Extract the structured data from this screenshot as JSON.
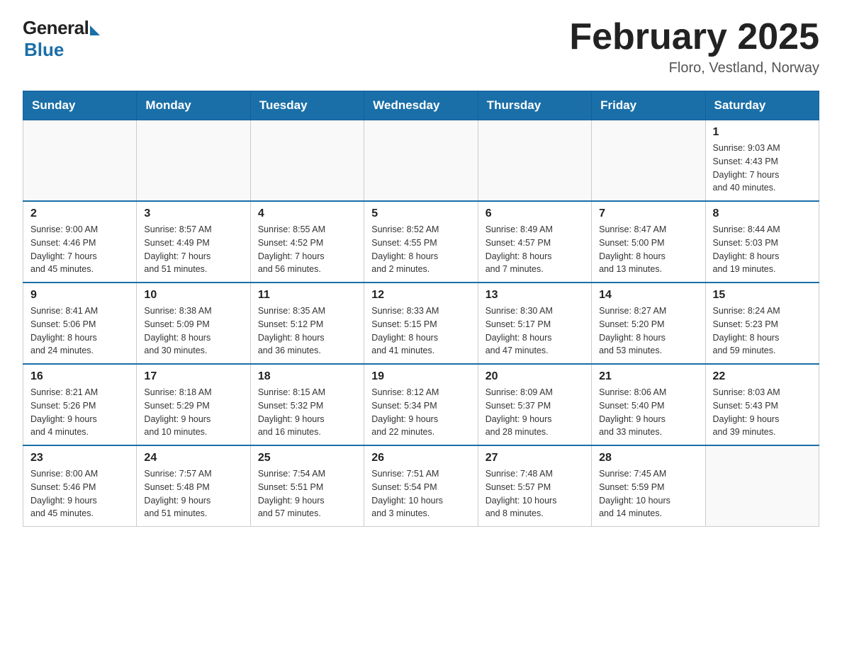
{
  "header": {
    "logo_general": "General",
    "logo_blue": "Blue",
    "main_title": "February 2025",
    "subtitle": "Floro, Vestland, Norway"
  },
  "days_of_week": [
    "Sunday",
    "Monday",
    "Tuesday",
    "Wednesday",
    "Thursday",
    "Friday",
    "Saturday"
  ],
  "weeks": [
    [
      {
        "day": "",
        "info": ""
      },
      {
        "day": "",
        "info": ""
      },
      {
        "day": "",
        "info": ""
      },
      {
        "day": "",
        "info": ""
      },
      {
        "day": "",
        "info": ""
      },
      {
        "day": "",
        "info": ""
      },
      {
        "day": "1",
        "info": "Sunrise: 9:03 AM\nSunset: 4:43 PM\nDaylight: 7 hours\nand 40 minutes."
      }
    ],
    [
      {
        "day": "2",
        "info": "Sunrise: 9:00 AM\nSunset: 4:46 PM\nDaylight: 7 hours\nand 45 minutes."
      },
      {
        "day": "3",
        "info": "Sunrise: 8:57 AM\nSunset: 4:49 PM\nDaylight: 7 hours\nand 51 minutes."
      },
      {
        "day": "4",
        "info": "Sunrise: 8:55 AM\nSunset: 4:52 PM\nDaylight: 7 hours\nand 56 minutes."
      },
      {
        "day": "5",
        "info": "Sunrise: 8:52 AM\nSunset: 4:55 PM\nDaylight: 8 hours\nand 2 minutes."
      },
      {
        "day": "6",
        "info": "Sunrise: 8:49 AM\nSunset: 4:57 PM\nDaylight: 8 hours\nand 7 minutes."
      },
      {
        "day": "7",
        "info": "Sunrise: 8:47 AM\nSunset: 5:00 PM\nDaylight: 8 hours\nand 13 minutes."
      },
      {
        "day": "8",
        "info": "Sunrise: 8:44 AM\nSunset: 5:03 PM\nDaylight: 8 hours\nand 19 minutes."
      }
    ],
    [
      {
        "day": "9",
        "info": "Sunrise: 8:41 AM\nSunset: 5:06 PM\nDaylight: 8 hours\nand 24 minutes."
      },
      {
        "day": "10",
        "info": "Sunrise: 8:38 AM\nSunset: 5:09 PM\nDaylight: 8 hours\nand 30 minutes."
      },
      {
        "day": "11",
        "info": "Sunrise: 8:35 AM\nSunset: 5:12 PM\nDaylight: 8 hours\nand 36 minutes."
      },
      {
        "day": "12",
        "info": "Sunrise: 8:33 AM\nSunset: 5:15 PM\nDaylight: 8 hours\nand 41 minutes."
      },
      {
        "day": "13",
        "info": "Sunrise: 8:30 AM\nSunset: 5:17 PM\nDaylight: 8 hours\nand 47 minutes."
      },
      {
        "day": "14",
        "info": "Sunrise: 8:27 AM\nSunset: 5:20 PM\nDaylight: 8 hours\nand 53 minutes."
      },
      {
        "day": "15",
        "info": "Sunrise: 8:24 AM\nSunset: 5:23 PM\nDaylight: 8 hours\nand 59 minutes."
      }
    ],
    [
      {
        "day": "16",
        "info": "Sunrise: 8:21 AM\nSunset: 5:26 PM\nDaylight: 9 hours\nand 4 minutes."
      },
      {
        "day": "17",
        "info": "Sunrise: 8:18 AM\nSunset: 5:29 PM\nDaylight: 9 hours\nand 10 minutes."
      },
      {
        "day": "18",
        "info": "Sunrise: 8:15 AM\nSunset: 5:32 PM\nDaylight: 9 hours\nand 16 minutes."
      },
      {
        "day": "19",
        "info": "Sunrise: 8:12 AM\nSunset: 5:34 PM\nDaylight: 9 hours\nand 22 minutes."
      },
      {
        "day": "20",
        "info": "Sunrise: 8:09 AM\nSunset: 5:37 PM\nDaylight: 9 hours\nand 28 minutes."
      },
      {
        "day": "21",
        "info": "Sunrise: 8:06 AM\nSunset: 5:40 PM\nDaylight: 9 hours\nand 33 minutes."
      },
      {
        "day": "22",
        "info": "Sunrise: 8:03 AM\nSunset: 5:43 PM\nDaylight: 9 hours\nand 39 minutes."
      }
    ],
    [
      {
        "day": "23",
        "info": "Sunrise: 8:00 AM\nSunset: 5:46 PM\nDaylight: 9 hours\nand 45 minutes."
      },
      {
        "day": "24",
        "info": "Sunrise: 7:57 AM\nSunset: 5:48 PM\nDaylight: 9 hours\nand 51 minutes."
      },
      {
        "day": "25",
        "info": "Sunrise: 7:54 AM\nSunset: 5:51 PM\nDaylight: 9 hours\nand 57 minutes."
      },
      {
        "day": "26",
        "info": "Sunrise: 7:51 AM\nSunset: 5:54 PM\nDaylight: 10 hours\nand 3 minutes."
      },
      {
        "day": "27",
        "info": "Sunrise: 7:48 AM\nSunset: 5:57 PM\nDaylight: 10 hours\nand 8 minutes."
      },
      {
        "day": "28",
        "info": "Sunrise: 7:45 AM\nSunset: 5:59 PM\nDaylight: 10 hours\nand 14 minutes."
      },
      {
        "day": "",
        "info": ""
      }
    ]
  ]
}
